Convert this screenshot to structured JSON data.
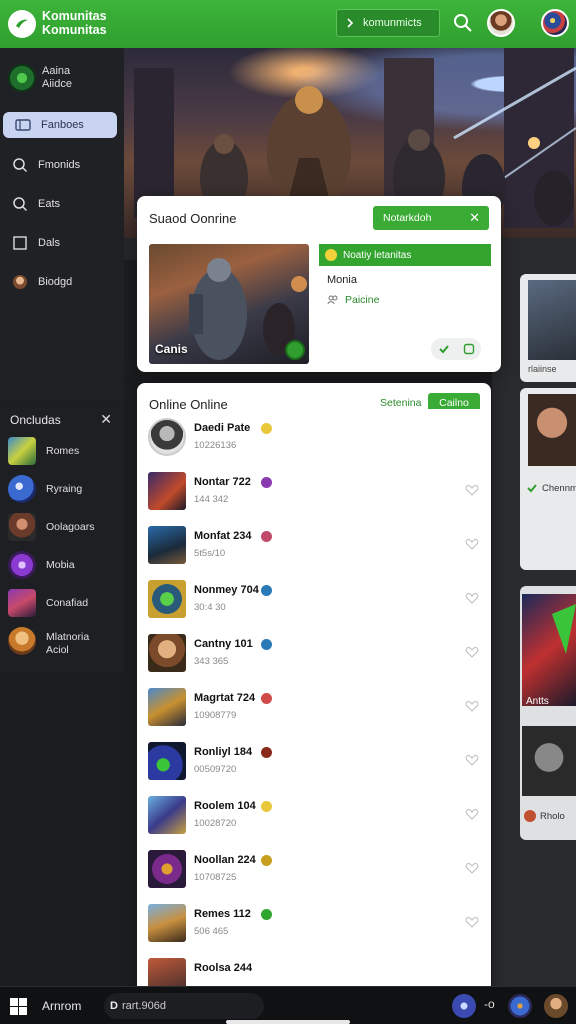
{
  "topbar": {
    "brand_line1": "Komunitas",
    "brand_line2": "Komunitas",
    "cta_label": "komunmicts",
    "accent": "#36ab35"
  },
  "sidebar": {
    "profile_line1": "Aaina",
    "profile_line2": "Aiidce",
    "items": [
      {
        "label": "Fanboes",
        "icon": "tablet-icon",
        "active": true
      },
      {
        "label": "Fmonids",
        "icon": "search-icon",
        "active": false
      },
      {
        "label": "Eats",
        "icon": "search-icon",
        "active": false
      },
      {
        "label": "Dals",
        "icon": "square-icon",
        "active": false
      },
      {
        "label": "Biodgd",
        "icon": "avatar-icon",
        "active": false
      }
    ]
  },
  "squad": {
    "title": "Suaod Oonrine",
    "notif_label": "Notarkdoh",
    "image_label": "Canis",
    "side_header": "Noatiy letanitas",
    "side_line1": "Monia",
    "side_line2": "Paicine"
  },
  "online": {
    "title": "Online Online",
    "filter_label": "Setenina",
    "pill_label": "Cailno",
    "rows": [
      {
        "name": "Daedi Pate",
        "sub": "10226136",
        "badge_color": "#e8c83a"
      },
      {
        "name": "Nontar 722",
        "sub": "144 342",
        "badge_color": "#8a3ab0"
      },
      {
        "name": "Monfat 234",
        "sub": "5t5s/10",
        "badge_color": "#c04a6a"
      },
      {
        "name": "Nonmey 704",
        "sub": "30:4 30",
        "badge_color": "#2a7ab8"
      },
      {
        "name": "Cantny 101",
        "sub": "343 365",
        "badge_color": "#2a7ab8"
      },
      {
        "name": "Magrtat 724",
        "sub": "10908779",
        "badge_color": "#d04a4a"
      },
      {
        "name": "Ronliyl 184",
        "sub": "00509720",
        "badge_color": "#8a2a1a"
      },
      {
        "name": "Roolem 104",
        "sub": "10028720",
        "badge_color": "#e8c83a"
      },
      {
        "name": "Noollan 224",
        "sub": "10708725",
        "badge_color": "#c8a020"
      },
      {
        "name": "Remes 112",
        "sub": "506 465",
        "badge_color": "#2fa52e"
      },
      {
        "name": "Roolsa 244",
        "sub": "",
        "badge_color": "#888888"
      }
    ]
  },
  "friends": {
    "header": "Oncludas",
    "items": [
      {
        "label": "Romes",
        "icon": "game-tile-icon"
      },
      {
        "label": "Ryraing",
        "icon": "game-tile-icon"
      },
      {
        "label": "Oolagoars",
        "icon": "game-tile-icon"
      },
      {
        "label": "Mobia",
        "icon": "game-tile-icon"
      },
      {
        "label": "Conafiad",
        "icon": "game-tile-icon"
      },
      {
        "label_line1": "Mlatnoria",
        "label_line2": "Aciol",
        "icon": "avatar-icon"
      }
    ]
  },
  "right_strip": {
    "card1_label": "rlaiinse",
    "card2_label": "Chennm",
    "card3_label": "Antts",
    "card4_label": "Rholo"
  },
  "taskbar": {
    "app_label": "Arnrom",
    "search_text": "rart.906d",
    "indicator": "-o"
  }
}
